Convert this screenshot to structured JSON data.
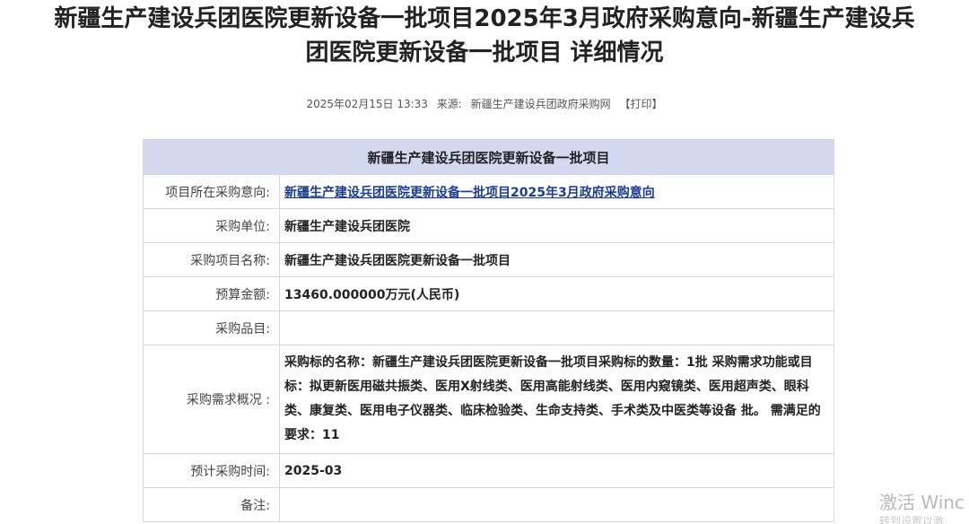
{
  "article": {
    "title_line1": "新疆生产建设兵团医院更新设备一批项目2025年3月政府采购意向-新疆生产建设兵",
    "title_line2": "团医院更新设备一批项目 详细情况",
    "date": "2025年02月15日 13:33",
    "source_label": "来源:",
    "source": "新疆生产建设兵团政府采购网",
    "print_label": "【打印】"
  },
  "table": {
    "header": "新疆生产建设兵团医院更新设备一批项目",
    "rows": {
      "intent": {
        "label": "项目所在采购意向:",
        "value": "新疆生产建设兵团医院更新设备一批项目2025年3月政府采购意向"
      },
      "unit": {
        "label": "采购单位:",
        "value": "新疆生产建设兵团医院"
      },
      "project_name": {
        "label": "采购项目名称:",
        "value": "新疆生产建设兵团医院更新设备一批项目"
      },
      "budget": {
        "label": "预算金额:",
        "value": "13460.000000万元(人民币)"
      },
      "items": {
        "label": "采购品目:",
        "value": ""
      },
      "requirements": {
        "label": "采购需求概况 :",
        "value": "采购标的名称：新疆生产建设兵团医院更新设备一批项目采购标的数量：1批 采购需求功能或目标：拟更新医用磁共振类、医用X射线类、医用高能射线类、医用内窥镜类、医用超声类、眼科类、康复类、医用电子仪器类、临床检验类、生命支持类、手术类及中医类等设备 批。 需满足的要求：11"
      },
      "time": {
        "label": "预计采购时间:",
        "value": "2025-03"
      },
      "remarks": {
        "label": "备注:",
        "value": ""
      }
    }
  },
  "watermark": {
    "line1": "激活 Winc",
    "line2": "转到设置以激"
  }
}
